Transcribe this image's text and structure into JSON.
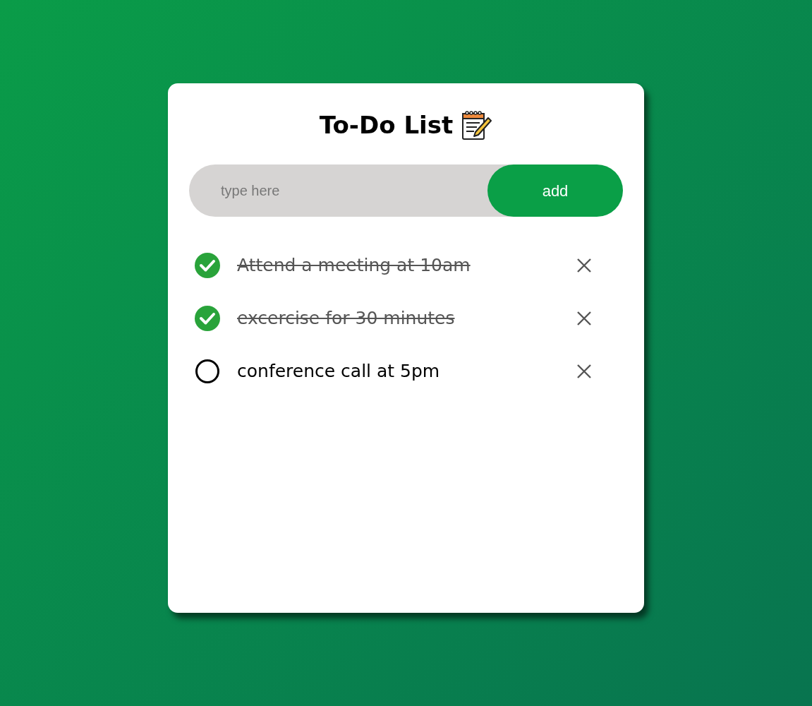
{
  "title": "To-Do List",
  "input": {
    "placeholder": "type here"
  },
  "add_button": "add",
  "tasks": [
    {
      "text": "Attend a meeting at 10am",
      "checked": true
    },
    {
      "text": "excercise for 30 minutes",
      "checked": true
    },
    {
      "text": "conference call at 5pm",
      "checked": false
    }
  ]
}
